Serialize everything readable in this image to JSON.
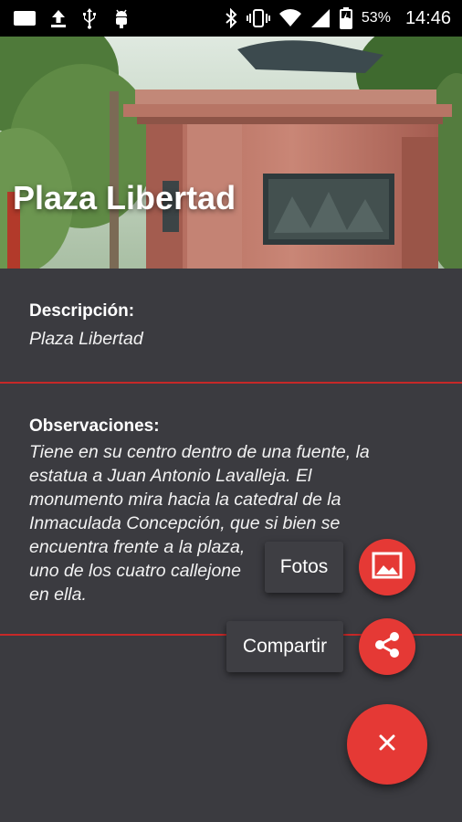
{
  "status_bar": {
    "battery_percent": "53%",
    "time": "14:46",
    "icons": [
      "notification-icon",
      "upload-icon",
      "usb-icon",
      "android-debug-icon",
      "bluetooth-icon",
      "vibrate-icon",
      "wifi-icon",
      "signal-icon",
      "battery-icon"
    ]
  },
  "header": {
    "title": "Plaza Libertad",
    "image": "monument-photo"
  },
  "description": {
    "label": "Descripción:",
    "value": "Plaza Libertad"
  },
  "observations": {
    "label": "Observaciones:",
    "lines": [
      "Tiene en su centro dentro de una fuente, la",
      "estatua a Juan Antonio Lavalleja. El",
      "monumento mira hacia la catedral de la",
      "Inmaculada Concepción, que si bien se",
      "encuentra frente a la plaza, ",
      "uno de los cuatro callejone",
      "en ella."
    ]
  },
  "fab_menu": {
    "photos_label": "Fotos",
    "share_label": "Compartir",
    "photos_icon": "image-icon",
    "share_icon": "share-icon",
    "close_icon": "close-icon"
  },
  "colors": {
    "accent": "#e53935",
    "divider": "#c62828",
    "background": "#3b3b40"
  }
}
